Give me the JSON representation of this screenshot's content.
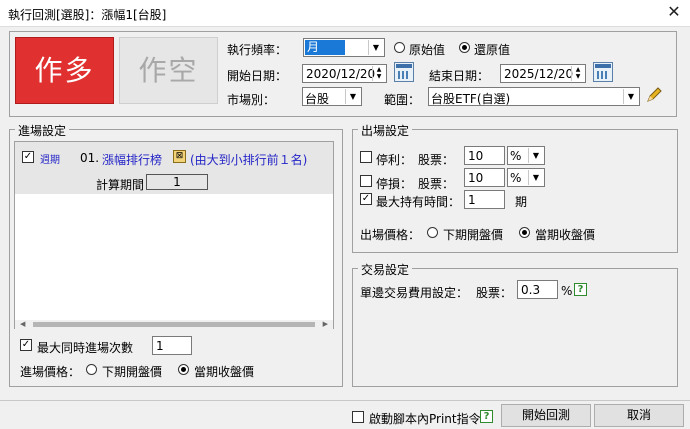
{
  "window": {
    "title": "執行回測[選股]：漲幅1[台股]",
    "close_glyph": "✕"
  },
  "top": {
    "long_label": "作多",
    "short_label": "作空",
    "freq_label": "執行頻率：",
    "freq_value": "月",
    "raw_label": "原始值",
    "adjusted_label": "還原值",
    "start_label": "開始日期：",
    "start_value": "2020/12/20",
    "end_label": "結束日期：",
    "end_value": "2025/12/20",
    "market_label": "市場別：",
    "market_value": "台股",
    "scope_label": "範圍：",
    "scope_value": "台股ETF(自選)"
  },
  "entry": {
    "group_title": "進場設定",
    "row_checked": "✓",
    "row_period_tag": "週期",
    "row_index": "01.",
    "row_name": "漲幅排行榜",
    "row_icon_text": "⊠",
    "row_desc": "(由大到小排行前１名)",
    "calc_label": "計算期間 =",
    "calc_value": "1",
    "max_label": "最大同時進場次數",
    "max_value": "1",
    "price_label": "進場價格：",
    "price_next_open": "下期開盤價",
    "price_close": "當期收盤價"
  },
  "exit": {
    "group_title": "出場設定",
    "take_profit_label": "停利：",
    "stock_label": "股票：",
    "take_profit_value": "10",
    "unit_value": "%",
    "stop_loss_label": "停損：",
    "stop_loss_value": "10",
    "max_hold_label": "最大持有時間：",
    "max_hold_value": "1",
    "max_hold_unit": "期",
    "price_label": "出場價格：",
    "price_next_open": "下期開盤價",
    "price_close": "當期收盤價"
  },
  "trade": {
    "group_title": "交易設定",
    "fee_label": "單邊交易費用設定：",
    "stock_label": "股票：",
    "fee_value": "0.3",
    "fee_unit": "%",
    "help_glyph": "?"
  },
  "bottom": {
    "print_label": "啟動腳本內Print指令",
    "help_glyph": "?",
    "start_button": "開始回測",
    "cancel_button": "取消"
  },
  "colors": {
    "long_button": "#e03030",
    "selected": "#1a78d6",
    "link_blue": "#2424c8",
    "help_green": "#2e8b2e"
  }
}
